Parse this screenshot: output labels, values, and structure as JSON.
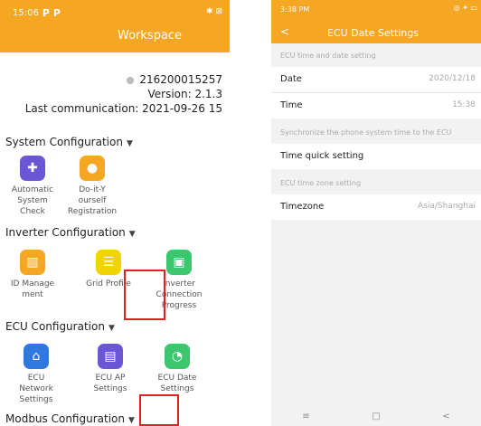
{
  "left": {
    "status_time": "15:06",
    "status_p1": "P",
    "status_p2": "P",
    "status_right": "✱ ⊠",
    "title": "Workspace",
    "device_id": "216200015257",
    "version": "Version: 2.1.3",
    "last_comm": "Last communication: 2021-09-26 15",
    "sections": {
      "system": "System Configuration",
      "inverter": "Inverter Configuration",
      "ecu": "ECU Configuration",
      "modbus": "Modbus Configuration"
    },
    "system_items": [
      {
        "label": "Automatic System Check",
        "icon": "medical-kit-icon"
      },
      {
        "label": "Do-it-Yourself Registration",
        "icon": "person-icon"
      }
    ],
    "system_labels": {
      "auto_1": "Automatic",
      "auto_2": "System",
      "auto_3": "Check",
      "diy_1": "Do-it-Y",
      "diy_2": "ourself",
      "diy_3": "Registration"
    },
    "inverter_labels": {
      "id_1": "ID Manage",
      "id_2": "ment",
      "grid": "Grid Profile",
      "conn_1": "Inverter",
      "conn_2": "Connection",
      "conn_3": "Progress"
    },
    "ecu_labels": {
      "net_1": "ECU",
      "net_2": "Network",
      "net_3": "Settings",
      "ap_1": "ECU AP",
      "ap_2": "Settings",
      "date_1": "ECU Date",
      "date_2": "Settings"
    },
    "icon_glyphs": {
      "medkit": "✚",
      "person": "●",
      "barcode": "▥",
      "sliders": "☰",
      "inverter": "▣",
      "ecu_net": "⌂",
      "ecu_ap": "▤",
      "clock": "◔"
    },
    "triangle": "▼"
  },
  "right": {
    "status_time": "3:38 PM",
    "status_icons": "◎ ✦ ▭",
    "back": "<",
    "title": "ECU Date Settings",
    "caption_time_date": "ECU time and date setting",
    "date_label": "Date",
    "date_value": "2020/12/18",
    "time_label": "Time",
    "time_value": "15:38",
    "caption_sync": "Synchronize the phone system time to the ECU",
    "quick_label": "Time quick setting",
    "caption_zone": "ECU time zone setting",
    "zone_label": "Timezone",
    "zone_value": "Asia/Shanghai",
    "nav": {
      "menu": "≡",
      "home": "□",
      "back": "<"
    }
  },
  "colors": {
    "header": "#f5a623",
    "highlight": "#e02020"
  }
}
